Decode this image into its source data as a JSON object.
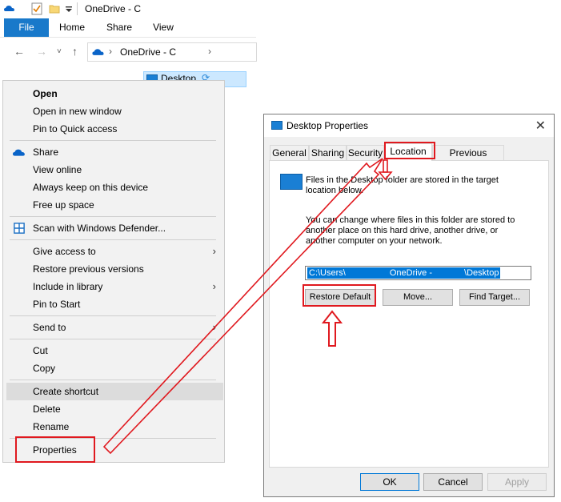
{
  "explorer": {
    "window_title": "OneDrive - C",
    "ribbon_tabs": [
      "File",
      "Home",
      "Share",
      "View"
    ],
    "address_crumb": "OneDrive - C",
    "selected_item": "Desktop"
  },
  "context_menu": {
    "open": "Open",
    "open_new_window": "Open in new window",
    "pin_quick_access": "Pin to Quick access",
    "share": "Share",
    "view_online": "View online",
    "always_keep": "Always keep on this device",
    "free_up_space": "Free up space",
    "scan_defender": "Scan with Windows Defender...",
    "give_access": "Give access to",
    "restore_versions": "Restore previous versions",
    "include_library": "Include in library",
    "pin_start": "Pin to Start",
    "send_to": "Send to",
    "cut": "Cut",
    "copy": "Copy",
    "create_shortcut": "Create shortcut",
    "delete": "Delete",
    "rename": "Rename",
    "properties": "Properties"
  },
  "dialog": {
    "title": "Desktop Properties",
    "tabs": [
      "General",
      "Sharing",
      "Security",
      "Location",
      "Previous Versions"
    ],
    "active_tab": "Location",
    "info_text": "Files in the Desktop folder are stored in the target location below.",
    "change_text": "You can change where files in this folder are stored to another place on this hard drive, another drive, or another computer on your network.",
    "path_start": "C:\\Users\\",
    "path_mid": "OneDrive -",
    "path_end": "\\Desktop",
    "restore_default": "Restore Default",
    "move": "Move...",
    "find_target": "Find Target...",
    "ok": "OK",
    "cancel": "Cancel",
    "apply": "Apply"
  },
  "colors": {
    "annotation_red": "#e0191f",
    "selection_blue": "#0078d7",
    "ribbon_file_blue": "#1979ca"
  }
}
